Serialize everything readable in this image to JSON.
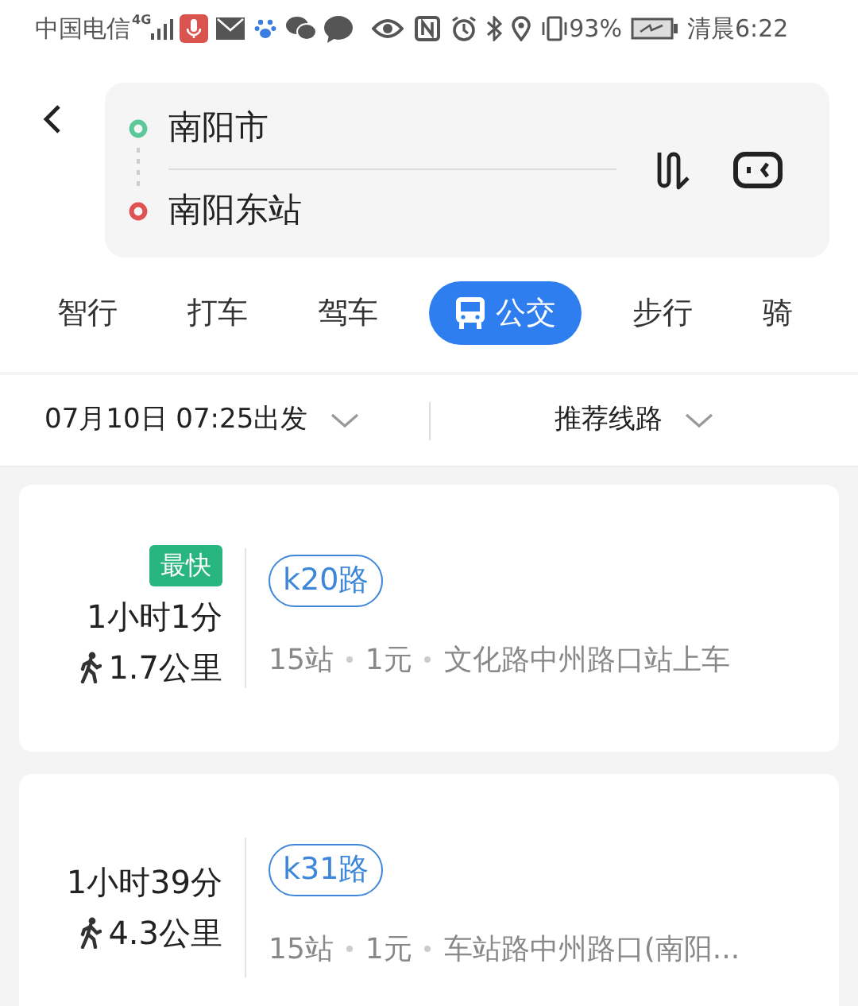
{
  "status_bar": {
    "carrier": "中国电信",
    "network": "4G",
    "battery_percent": "93%",
    "time": "清晨6:22"
  },
  "route_input": {
    "origin": "南阳市",
    "destination": "南阳东站"
  },
  "tabs": [
    {
      "label": "智行",
      "selected": false
    },
    {
      "label": "打车",
      "selected": false
    },
    {
      "label": "驾车",
      "selected": false
    },
    {
      "label": "公交",
      "selected": true
    },
    {
      "label": "步行",
      "selected": false
    },
    {
      "label": "骑",
      "selected": false
    }
  ],
  "filters": {
    "departure": "07月10日 07:25出发",
    "sort": "推荐线路"
  },
  "routes": [
    {
      "badge": "最快",
      "duration": "1小时1分",
      "walk": "1.7公里",
      "line": "k20路",
      "stops": "15站",
      "fare": "1元",
      "boarding": "文化路中州路口站上车"
    },
    {
      "duration": "1小时39分",
      "walk": "4.3公里",
      "line": "k31路",
      "stops": "15站",
      "fare": "1元",
      "boarding": "车站路中州路口(南阳..."
    }
  ]
}
